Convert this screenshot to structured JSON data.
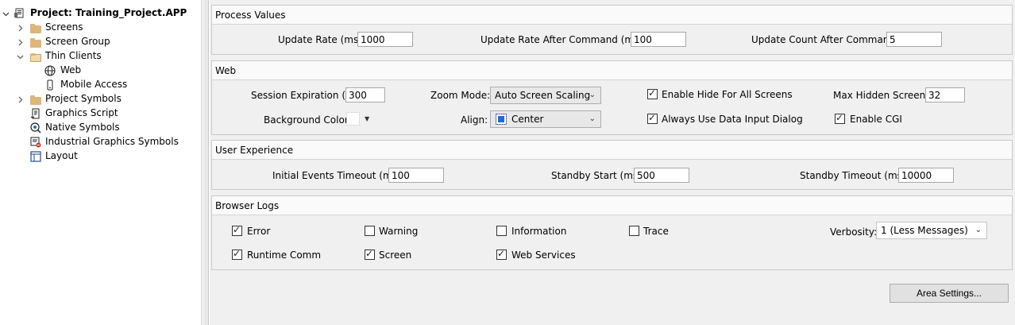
{
  "tree": {
    "project": "Project: Training_Project.APP",
    "items": [
      {
        "label": "Screens"
      },
      {
        "label": "Screen Group"
      },
      {
        "label": "Thin Clients"
      },
      {
        "label": "Web"
      },
      {
        "label": "Mobile Access"
      },
      {
        "label": "Project Symbols"
      },
      {
        "label": "Graphics Script"
      },
      {
        "label": "Native Symbols"
      },
      {
        "label": "Industrial Graphics Symbols"
      },
      {
        "label": "Layout"
      }
    ]
  },
  "process": {
    "title": "Process Values",
    "update_rate_label": "Update Rate (ms):",
    "update_rate": "1000",
    "after_cmd_label": "Update Rate After Command (ms):",
    "after_cmd": "100",
    "count_label": "Update Count After Command:",
    "count": "5"
  },
  "web": {
    "title": "Web",
    "session_label": "Session Expiration (s):",
    "session": "300",
    "zoom_label": "Zoom Mode:",
    "zoom": "Auto Screen Scaling",
    "hide_label": "Enable Hide For All Screens",
    "hide_checked": true,
    "max_hidden_label": "Max Hidden Screens:",
    "max_hidden": "32",
    "bg_label": "Background Color:",
    "bg_color": "#ffffff",
    "align_label": "Align:",
    "align": "Center",
    "data_input_label": "Always Use Data Input Dialog",
    "data_input_checked": true,
    "cgi_label": "Enable CGI",
    "cgi_checked": true
  },
  "ux": {
    "title": "User Experience",
    "initial_label": "Initial Events Timeout (ms):",
    "initial": "100",
    "standby_start_label": "Standby Start (ms):",
    "standby_start": "500",
    "standby_timeout_label": "Standby Timeout (ms):",
    "standby_timeout": "10000"
  },
  "logs": {
    "title": "Browser Logs",
    "error": "Error",
    "warning": "Warning",
    "information": "Information",
    "trace": "Trace",
    "runtime": "Runtime Comm",
    "screen": "Screen",
    "webservices": "Web Services",
    "verbosity_label": "Verbosity:",
    "verbosity": "1 (Less Messages)"
  },
  "buttons": {
    "area_settings": "Area Settings..."
  }
}
